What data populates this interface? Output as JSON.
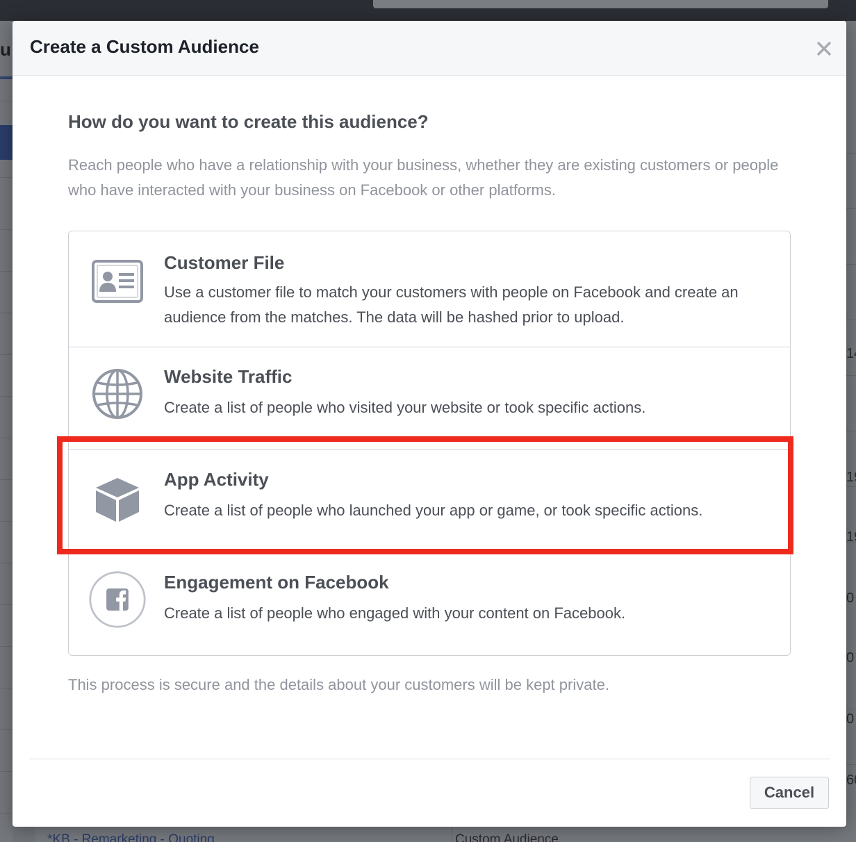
{
  "dialog": {
    "title": "Create a Custom Audience",
    "close_icon": "close-icon",
    "question": "How do you want to create this audience?",
    "intro": "Reach people who have a relationship with your business, whether they are existing customers or people who have interacted with your business on Facebook or other platforms.",
    "options": [
      {
        "icon": "contact-card-icon",
        "title": "Customer File",
        "description": "Use a customer file to match your customers with people on Facebook and create an audience from the matches. The data will be hashed prior to upload."
      },
      {
        "icon": "globe-icon",
        "title": "Website Traffic",
        "description": "Create a list of people who visited your website or took specific actions."
      },
      {
        "icon": "cube-icon",
        "title": "App Activity",
        "description": "Create a list of people who launched your app or game, or took specific actions.",
        "highlighted": true
      },
      {
        "icon": "facebook-icon",
        "title": "Engagement on Facebook",
        "description": "Create a list of people who engaged with your content on Facebook."
      }
    ],
    "footnote": "This process is secure and the details about your customers will be kept private.",
    "cancel_label": "Cancel"
  },
  "background": {
    "left_letter": "u",
    "right_numbers": [
      "14",
      "19",
      "19",
      "0",
      "0",
      "0",
      "60"
    ],
    "bottom_link": "*KB - Remarketing - Quoting",
    "bottom_text": "Custom Audience"
  },
  "colors": {
    "highlight": "#ee2a1f",
    "title_text": "#1d2129",
    "body_text": "#4b4f56",
    "muted_text": "#90949c",
    "icon_gray": "#9197a3",
    "header_bg": "#f6f7f9"
  }
}
